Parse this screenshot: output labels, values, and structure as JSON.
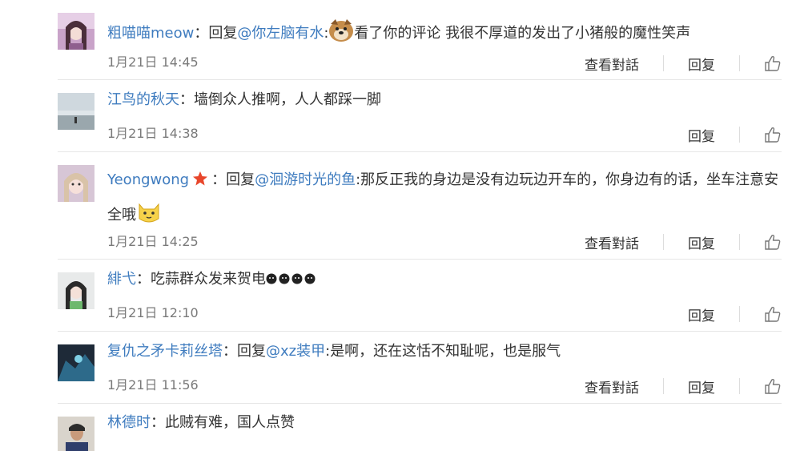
{
  "labels": {
    "view_thread": "查看對話",
    "reply": "回复",
    "reply_prefix": "回复"
  },
  "comments": [
    {
      "user": "粗喵喵meow",
      "sep": "：",
      "mention": "@你左脑有水",
      "mention_colon": ":",
      "text": "看了你的评论 我很不厚道的发出了小猪般的魔性笑声",
      "time": "1月21日 14:45",
      "emoji": "doge-emoji"
    },
    {
      "user": "江鸟的秋天",
      "sep": "：",
      "text": "墙倒众人推啊，人人都踩一脚",
      "time": "1月21日 14:38"
    },
    {
      "user": "Yeongwong",
      "sep": "：",
      "mention": "@洄游时光的鱼",
      "mention_colon": ":",
      "text": "那反正我的身边是没有边玩边开车的，你身边有的话，坐车注意安全哦",
      "time": "1月21日 14:25",
      "badge": "star-icon",
      "emoji": "doge-cat-emoji"
    },
    {
      "user": "緋弋",
      "sep": "：",
      "text": "吃蒜群众发来贺电",
      "time": "1月21日 12:10",
      "emoji": "sweat-emoji"
    },
    {
      "user": "复仇之矛卡莉丝塔",
      "sep": "：",
      "mention": "@xz装甲",
      "mention_colon": ":",
      "text": "是啊，还在这恬不知耻呢，也是服气",
      "time": "1月21日 11:56"
    },
    {
      "user": "林德时",
      "sep": "：",
      "text": "此贼有难，国人点赞"
    }
  ],
  "colors": {
    "username": "#3f7cbf",
    "text": "#333333",
    "time": "#7a7a7a",
    "divider": "#e6e6e6"
  }
}
